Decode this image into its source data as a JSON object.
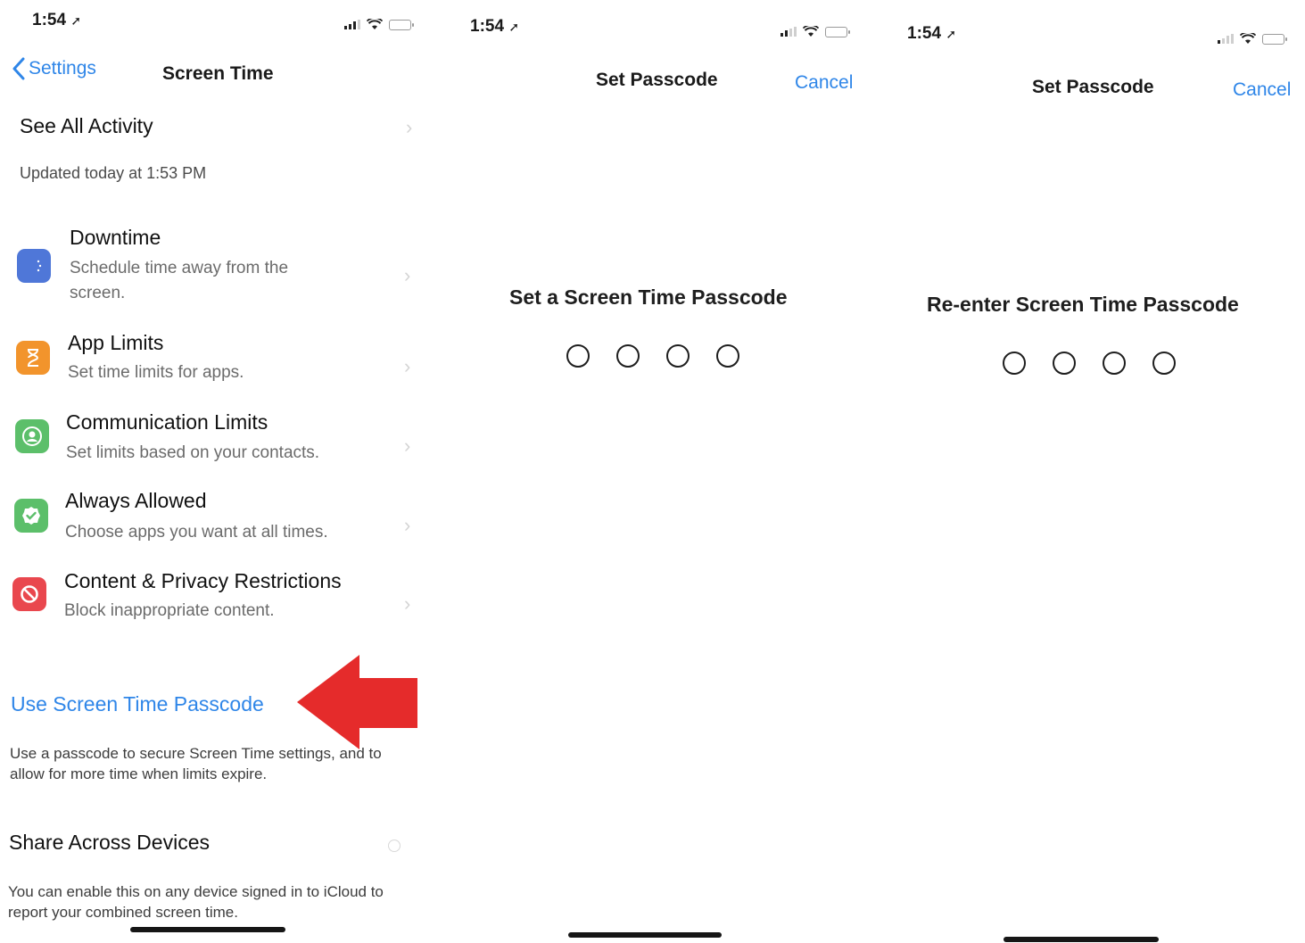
{
  "status_bar": {
    "time": "1:54"
  },
  "screen_time": {
    "back_label": "Settings",
    "title": "Screen Time",
    "see_all": "See All Activity",
    "updated": "Updated today at 1:53 PM",
    "rows": [
      {
        "title": "Downtime",
        "subtitle": "Schedule time away from the screen.",
        "icon": "moon-icon",
        "color": "#4f77d8"
      },
      {
        "title": "App Limits",
        "subtitle": "Set time limits for apps.",
        "icon": "hourglass-icon",
        "color": "#f2942c"
      },
      {
        "title": "Communication Limits",
        "subtitle": "Set limits based on your contacts.",
        "icon": "person-circle-icon",
        "color": "#5cbf6a"
      },
      {
        "title": "Always Allowed",
        "subtitle": "Choose apps you want at all times.",
        "icon": "checkmark-badge-icon",
        "color": "#5cbf6a"
      },
      {
        "title": "Content & Privacy Restrictions",
        "subtitle": "Block inappropriate content.",
        "icon": "prohibited-icon",
        "color": "#e9474e"
      }
    ],
    "passcode_link": "Use Screen Time Passcode",
    "passcode_note": "Use a passcode to secure Screen Time settings, and to allow for more time when limits expire.",
    "share_label": "Share Across Devices",
    "share_note": "You can enable this on any device signed in to iCloud to report your combined screen time."
  },
  "set_passcode": {
    "title": "Set Passcode",
    "cancel": "Cancel",
    "prompt": "Set a Screen Time Passcode",
    "digits": 4
  },
  "reenter_passcode": {
    "title": "Set Passcode",
    "cancel": "Cancel",
    "prompt": "Re-enter Screen Time Passcode",
    "digits": 4
  },
  "annotation": {
    "arrow_color": "#e52b2b"
  },
  "colors": {
    "link": "#2f86e8"
  }
}
